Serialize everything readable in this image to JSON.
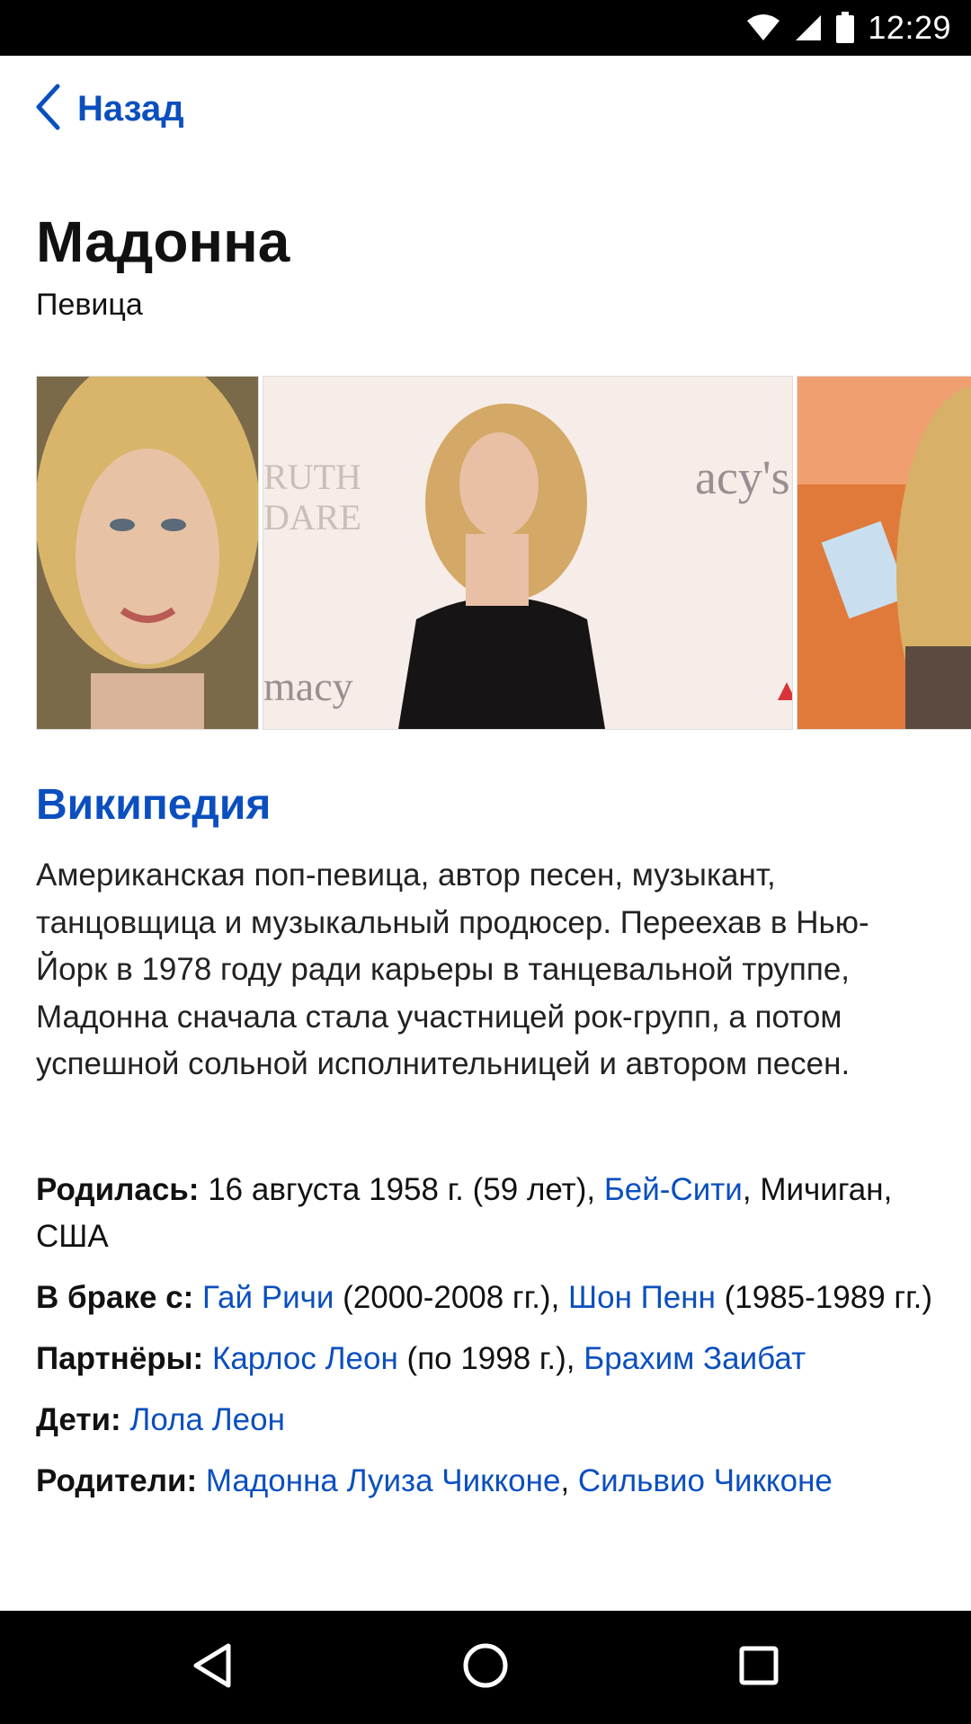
{
  "status_bar": {
    "time": "12:29",
    "icons": [
      "wifi-icon",
      "cell-signal-icon",
      "battery-icon"
    ]
  },
  "header": {
    "back_label": "Назад",
    "back_icon": "chevron-left-icon"
  },
  "entity": {
    "title": "Мадонна",
    "subtitle": "Певица"
  },
  "gallery": {
    "images": [
      "portrait-photo",
      "red-carpet-photo",
      "event-photo"
    ]
  },
  "wikipedia": {
    "heading": "Википедия",
    "text": "Американская поп-певица, автор песен, музыкант, танцовщица и музыкальный продюсер. Переехав в Нью-Йорк в 1978 году ради карьеры в танцевальной труппе, Мадонна сначала стала участницей рок-групп, а потом успешной сольной исполнительницей и автором песен."
  },
  "facts": {
    "born": {
      "label": "Родилась:",
      "text": " 16 августа 1958 г. (59 лет), ",
      "link": "Бей-Сити",
      "suffix": ", Мичиган, США"
    },
    "spouse": {
      "label": "В браке с:",
      "link1": "Гай Ричи",
      "text1": " (2000-2008 гг.), ",
      "link2": "Шон Пенн",
      "text2": " (1985-1989 гг.)"
    },
    "partners": {
      "label": "Партнёры:",
      "link1": "Карлос Леон",
      "text1": " (по 1998 г.), ",
      "link2": "Брахим Заибат"
    },
    "children": {
      "label": "Дети:",
      "link1": "Лола Леон"
    },
    "parents": {
      "label": "Родители:",
      "link1": "Мадонна Луиза Чикконе",
      "sep": ", ",
      "link2": "Сильвио Чикконе"
    }
  },
  "nav_bar": {
    "buttons": [
      "back-triangle-icon",
      "home-circle-icon",
      "recents-square-icon"
    ]
  },
  "colors": {
    "link": "#0b4fbf",
    "text": "#111111",
    "bars": "#000000"
  }
}
